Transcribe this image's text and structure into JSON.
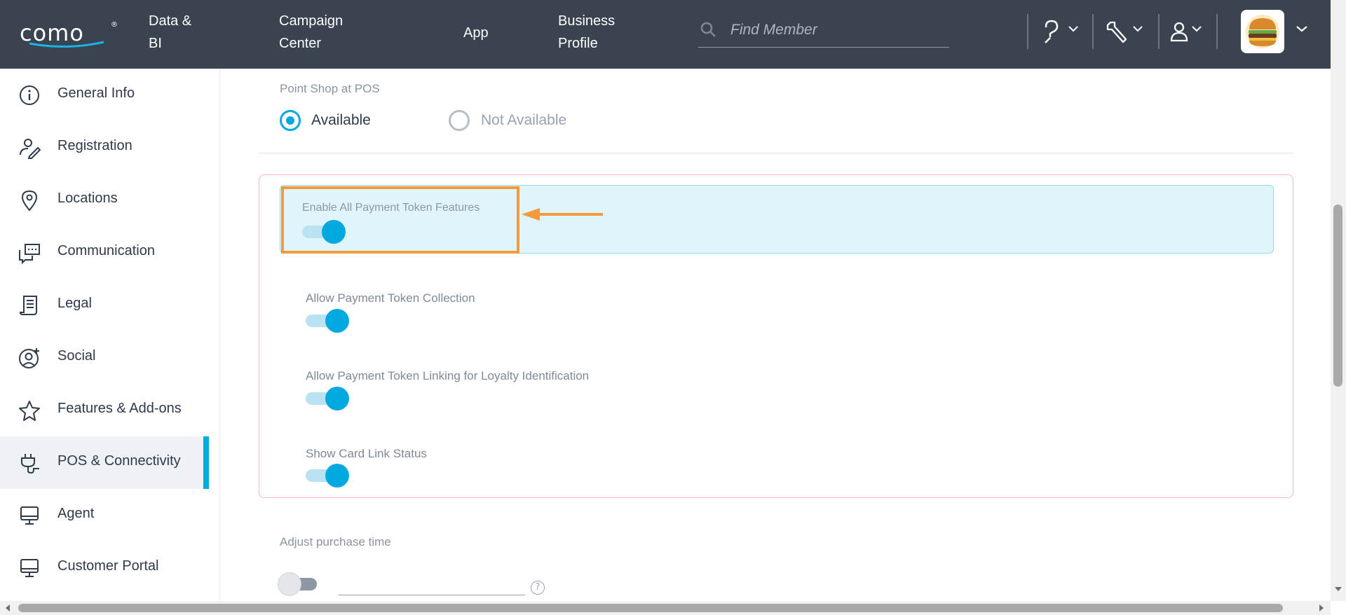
{
  "brand": {
    "logo_text": "como",
    "registered": "®"
  },
  "topnav": {
    "items": [
      {
        "line1": "Data &",
        "line2": "BI"
      },
      {
        "line1": "Campaign",
        "line2": "Center"
      },
      {
        "line1": "App",
        "line2": ""
      },
      {
        "line1": "Business",
        "line2": "Profile"
      }
    ],
    "search_placeholder": "Find Member",
    "icons": [
      "help-icon",
      "wrench-icon",
      "user-icon"
    ]
  },
  "sidebar": {
    "items": [
      {
        "label": "General Info",
        "icon": "info-icon"
      },
      {
        "label": "Registration",
        "icon": "user-pen-icon"
      },
      {
        "label": "Locations",
        "icon": "location-pin-icon"
      },
      {
        "label": "Communication",
        "icon": "chat-icon"
      },
      {
        "label": "Legal",
        "icon": "document-icon"
      },
      {
        "label": "Social",
        "icon": "user-add-icon"
      },
      {
        "label": "Features & Add-ons",
        "icon": "star-icon"
      },
      {
        "label": "POS & Connectivity",
        "icon": "plug-icon",
        "active": true
      },
      {
        "label": "Agent",
        "icon": "monitor-icon"
      },
      {
        "label": "Customer Portal",
        "icon": "monitor-icon"
      }
    ]
  },
  "main": {
    "point_shop": {
      "label": "Point Shop at POS",
      "options": [
        {
          "label": "Available",
          "selected": true
        },
        {
          "label": "Not Available",
          "selected": false
        }
      ]
    },
    "payment_tokens": {
      "enable_all_label": "Enable All Payment Token Features",
      "enable_all_on": true,
      "settings": [
        {
          "label": "Allow Payment Token Collection",
          "on": true
        },
        {
          "label": "Allow Payment Token Linking for Loyalty Identification",
          "on": true
        },
        {
          "label": "Show Card Link Status",
          "on": true
        }
      ]
    },
    "adjust_purchase": {
      "label": "Adjust purchase time",
      "on": false,
      "help": "?"
    }
  },
  "colors": {
    "accent": "#00a9e0",
    "topbar": "#3a4350",
    "annotation": "#f39a3c"
  }
}
